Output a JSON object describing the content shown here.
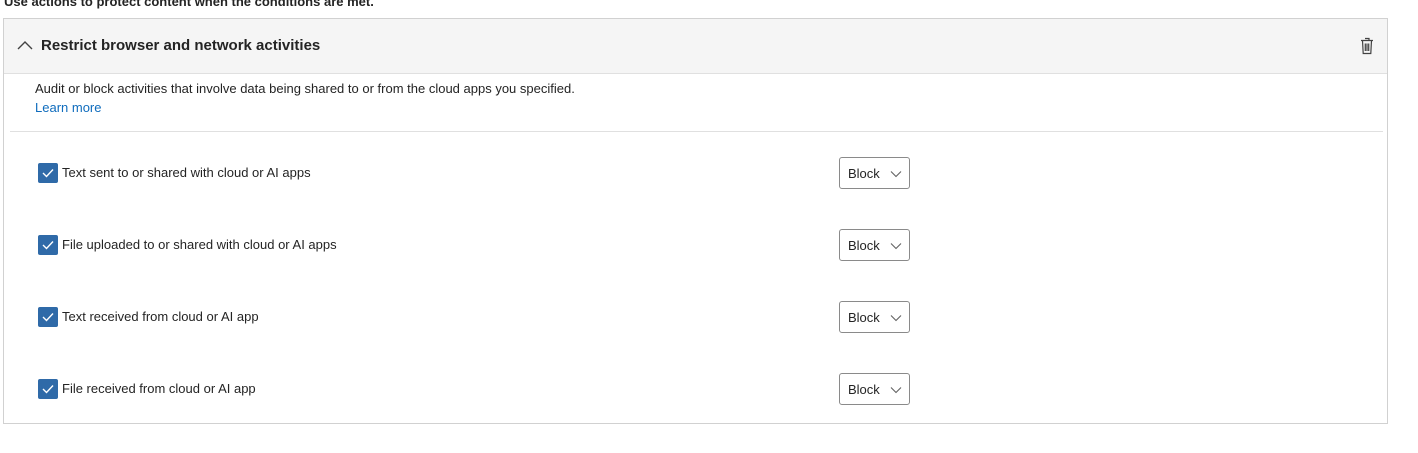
{
  "caption": "Use actions to protect content when the conditions are met.",
  "section": {
    "title": "Restrict browser and network activities",
    "description": "Audit or block activities that involve data being shared to or from the cloud apps you specified.",
    "learn_more": "Learn more",
    "activities": [
      {
        "label": "Text sent to or shared with cloud or AI apps",
        "checked": true,
        "action": "Block"
      },
      {
        "label": "File uploaded to or shared with cloud or AI apps",
        "checked": true,
        "action": "Block"
      },
      {
        "label": "Text received from cloud or AI app",
        "checked": true,
        "action": "Block"
      },
      {
        "label": "File received from cloud or AI app",
        "checked": true,
        "action": "Block"
      }
    ]
  },
  "colors": {
    "accent": "#2f6aa8",
    "link": "#0f6cbd",
    "header_bg": "#f5f5f5",
    "border": "#d1d1d1"
  },
  "icons": {
    "collapse": "chevron-up-icon",
    "delete": "trash-icon",
    "check": "checkmark-icon",
    "dropdown": "chevron-down-icon"
  }
}
